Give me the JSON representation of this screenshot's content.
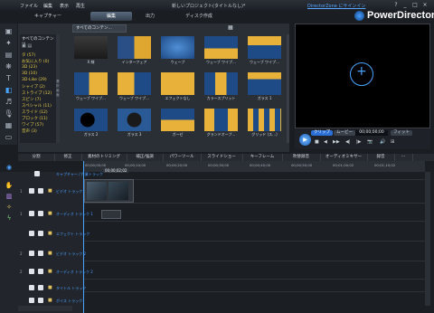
{
  "window": {
    "menu": [
      "ファイル",
      "編集",
      "表示",
      "再生"
    ],
    "title": "新しいプロジェクト(タイトルなし)*",
    "directorzone": "DirectorZone にサインイン",
    "controls": [
      "?",
      "_",
      "□",
      "×"
    ]
  },
  "tabs": [
    {
      "label": "キャプチャー",
      "active": false
    },
    {
      "label": "編集",
      "active": true
    },
    {
      "label": "出力",
      "active": false
    },
    {
      "label": "ディスク作成",
      "active": false
    }
  ],
  "brand": "PowerDirector",
  "library": {
    "dropdown": "すべてのコンテン…",
    "category_header": "すべてのコンテンツ",
    "categories": [
      "タ  (57)",
      "お気に入り (0)",
      "3D  (23)",
      "3D (10)",
      "3D-Like (29)",
      "シャイプ (2)",
      "ストライプ (12)",
      "スピン (7)",
      "スペシャル (11)",
      "スライド (12)",
      "ブロック (11)",
      "ワイプ (57)",
      "音声 (3)"
    ],
    "splitter_label": "選択画面",
    "thumbnails": [
      {
        "label": "X 線"
      },
      {
        "label": "インターフェア"
      },
      {
        "label": "ウェーブ"
      },
      {
        "label": "ウェーブ ワイプ…"
      },
      {
        "label": "ウェーブ ワイプ…"
      },
      {
        "label": "ウェーブ ワイプ…"
      },
      {
        "label": "ウェーブ ワイプ…"
      },
      {
        "label": "エフェクトなし"
      },
      {
        "label": "カラースプリット"
      },
      {
        "label": "ガラス 1"
      },
      {
        "label": "ガラス 2"
      },
      {
        "label": "ガラス 3"
      },
      {
        "label": "ガーゼ"
      },
      {
        "label": "グランドオープ…"
      },
      {
        "label": "グリッド (ス…)"
      }
    ]
  },
  "preview": {
    "clip_label": "クリップ",
    "movie_label": "ムービー",
    "timecode": "00;00;00;00",
    "fit_label": "フィット",
    "play_symbol": "▶",
    "controls": [
      "■",
      "◀",
      "▶▶",
      "◀|",
      "|▶",
      "📷",
      "🔊",
      "⊞"
    ]
  },
  "edit_toolbar": [
    "分割",
    "修正",
    "素材のトリミング",
    "補正/強調",
    "パワーツール",
    "スライドショー",
    "キーフレーム",
    "吹替録音",
    "オーディオミキサー",
    "録音",
    "⋯"
  ],
  "timeline": {
    "ruler": [
      "00;00;00;00",
      "00;00;10;00",
      "00;00;20;00",
      "00;00;30;00",
      "00;00;40;00",
      "00;00;50;00",
      "00;01;00;02",
      "00;01;10;02"
    ],
    "tooltip": "00;00;02;02",
    "tracks": [
      {
        "num": "",
        "name": "ビデオ トラック 1"
      },
      {
        "num": "1",
        "name": "ビデオ トラック 1"
      },
      {
        "num": "1",
        "name": "オーディオ トラック 1"
      },
      {
        "num": "",
        "name": "エフェクト トラック"
      },
      {
        "num": "2",
        "name": "ビデオ トラック 2"
      },
      {
        "num": "2",
        "name": "オーディオ トラック 2"
      },
      {
        "num": "",
        "name": "タイトル トラック"
      },
      {
        "num": "",
        "name": "ボイス トラック"
      },
      {
        "num": "",
        "name": "ミュージック トラック"
      }
    ],
    "header_label": "キャプチャー / 作業トラック"
  },
  "colors": {
    "accent": "#4aa3ff",
    "category_text": "#e2c84a",
    "track_name": "#4a9eff"
  }
}
